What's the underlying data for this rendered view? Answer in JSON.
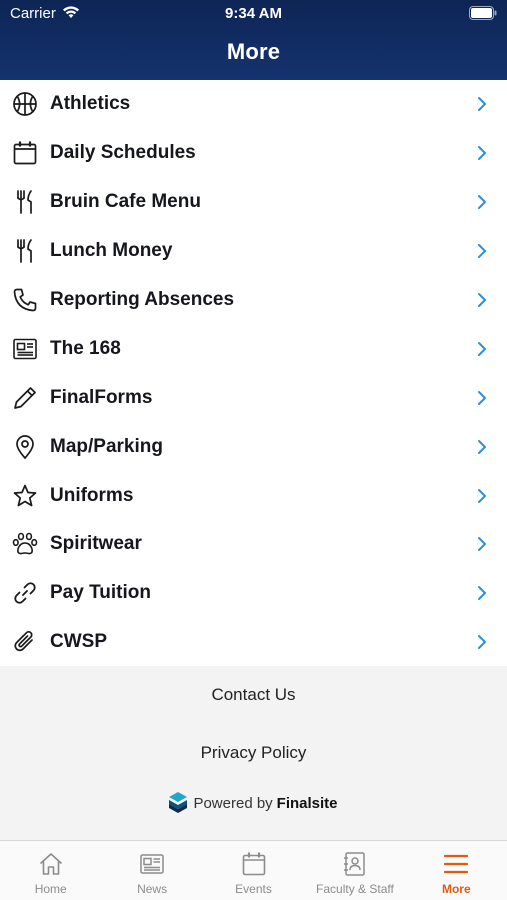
{
  "status": {
    "carrier": "Carrier",
    "time": "9:34 AM"
  },
  "nav": {
    "title": "More"
  },
  "menu": [
    {
      "label": "Athletics",
      "icon": "basketball-icon"
    },
    {
      "label": "Daily Schedules",
      "icon": "calendar-icon"
    },
    {
      "label": "Bruin Cafe Menu",
      "icon": "utensils-icon"
    },
    {
      "label": "Lunch Money",
      "icon": "utensils-icon"
    },
    {
      "label": "Reporting Absences",
      "icon": "phone-icon"
    },
    {
      "label": "The 168",
      "icon": "newspaper-icon"
    },
    {
      "label": "FinalForms",
      "icon": "pencil-icon"
    },
    {
      "label": "Map/Parking",
      "icon": "map-pin-icon"
    },
    {
      "label": "Uniforms",
      "icon": "star-icon"
    },
    {
      "label": "Spiritwear",
      "icon": "paw-icon"
    },
    {
      "label": "Pay Tuition",
      "icon": "link-icon"
    },
    {
      "label": "CWSP",
      "icon": "paperclip-icon"
    }
  ],
  "footer": {
    "contact": "Contact Us",
    "privacy": "Privacy Policy",
    "powered_by": "Powered by",
    "brand": "Finalsite"
  },
  "tabs": [
    {
      "label": "Home",
      "icon": "home-icon",
      "active": false
    },
    {
      "label": "News",
      "icon": "news-icon",
      "active": false
    },
    {
      "label": "Events",
      "icon": "calendar-icon",
      "active": false
    },
    {
      "label": "Faculty & Staff",
      "icon": "contact-book-icon",
      "active": false
    },
    {
      "label": "More",
      "icon": "hamburger-menu-icon",
      "active": true
    }
  ],
  "colors": {
    "header": "#15336f",
    "chevron": "#2b8ee0",
    "active_tab": "#e05a13",
    "inactive_tab": "#8c8c8c"
  }
}
